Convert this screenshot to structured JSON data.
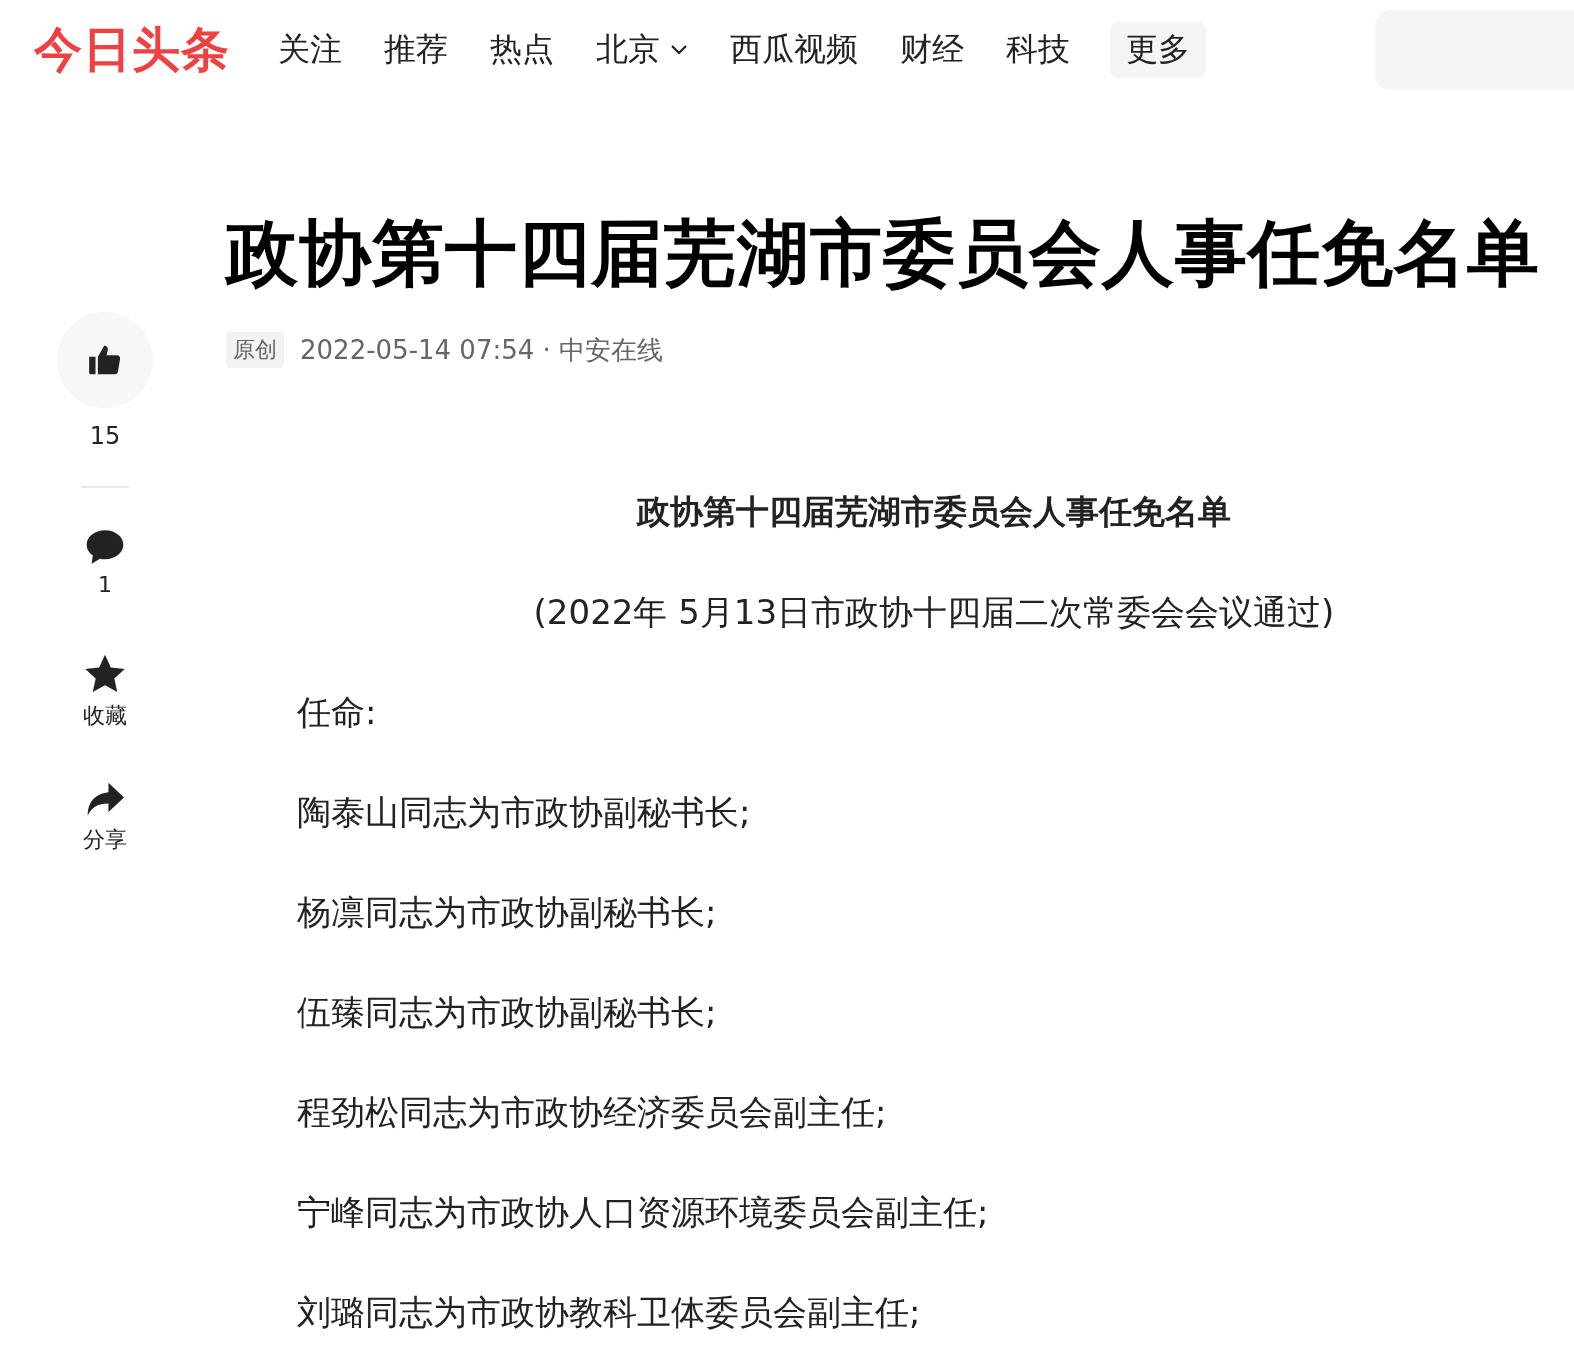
{
  "header": {
    "logo": "今日头条",
    "nav": [
      {
        "label": "关注",
        "kind": "link"
      },
      {
        "label": "推荐",
        "kind": "link"
      },
      {
        "label": "热点",
        "kind": "link"
      },
      {
        "label": "北京",
        "kind": "dropdown"
      },
      {
        "label": "西瓜视频",
        "kind": "link"
      },
      {
        "label": "财经",
        "kind": "link"
      },
      {
        "label": "科技",
        "kind": "link"
      },
      {
        "label": "更多",
        "kind": "more"
      }
    ],
    "search": {
      "kind": "field"
    }
  },
  "sidebar": {
    "actions": [
      {
        "kind": "like",
        "label": "15"
      },
      {
        "kind": "comment",
        "label": "1"
      },
      {
        "kind": "favorite",
        "label": "收藏"
      },
      {
        "kind": "share",
        "label": "分享"
      }
    ]
  },
  "article": {
    "title": "政协第十四届芜湖市委员会人事任免名单",
    "tag": "原创",
    "meta": "2022-05-14 07:54 · 中安在线",
    "body": [
      {
        "kind": "heading",
        "text": "政协第十四届芜湖市委员会人事任免名单"
      },
      {
        "kind": "center",
        "text": "(2022年 5月13日市政协十四届二次常委会会议通过)"
      },
      {
        "kind": "para",
        "text": "任命:"
      },
      {
        "kind": "para",
        "text": "陶泰山同志为市政协副秘书长;"
      },
      {
        "kind": "para",
        "text": "杨凛同志为市政协副秘书长;"
      },
      {
        "kind": "para",
        "text": "伍臻同志为市政协副秘书长;"
      },
      {
        "kind": "para",
        "text": "程劲松同志为市政协经济委员会副主任;"
      },
      {
        "kind": "para",
        "text": "宁峰同志为市政协人口资源环境委员会副主任;"
      },
      {
        "kind": "para",
        "text": "刘璐同志为市政协教科卫体委员会副主任;"
      }
    ]
  }
}
